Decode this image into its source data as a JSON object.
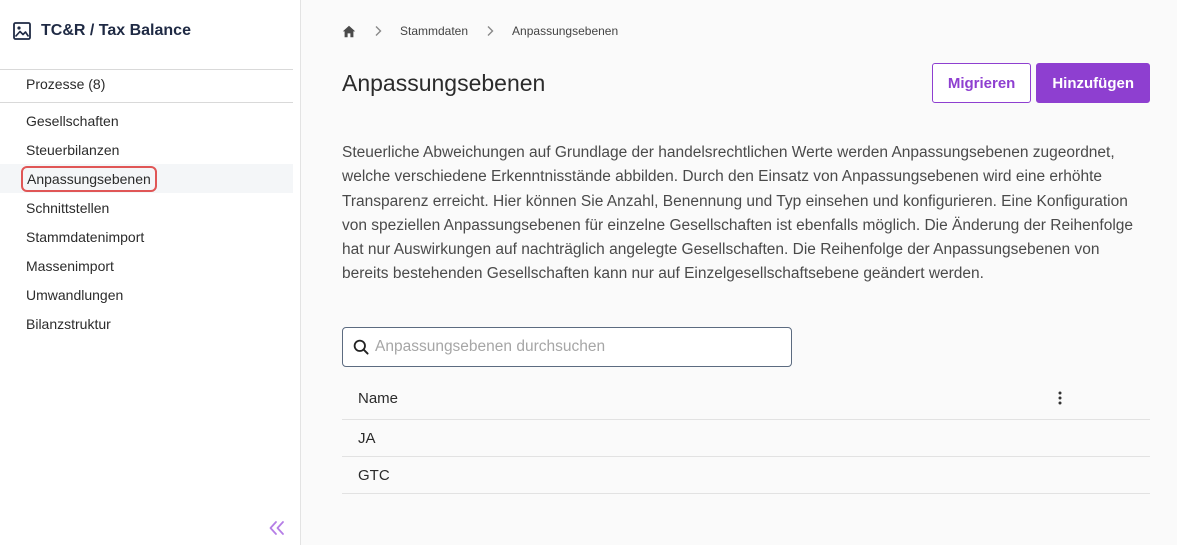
{
  "app": {
    "title": "TC&R / Tax Balance",
    "logo_icon": "image-icon"
  },
  "sidebar": {
    "processes_label": "Prozesse (8)",
    "items": [
      {
        "label": "Gesellschaften"
      },
      {
        "label": "Steuerbilanzen"
      },
      {
        "label": "Anpassungsebenen",
        "active": true
      },
      {
        "label": "Schnittstellen"
      },
      {
        "label": "Stammdatenimport"
      },
      {
        "label": "Massenimport"
      },
      {
        "label": "Umwandlungen"
      },
      {
        "label": "Bilanzstruktur"
      }
    ],
    "collapse_icon": "double-chevron-left-icon"
  },
  "breadcrumb": {
    "home_icon": "home-icon",
    "items": [
      "Stammdaten",
      "Anpassungsebenen"
    ]
  },
  "page": {
    "title": "Anpassungsebenen",
    "migrate_label": "Migrieren",
    "add_label": "Hinzufügen",
    "description": "Steuerliche Abweichungen auf Grundlage der handelsrechtlichen Werte werden Anpassungsebenen zugeordnet, welche verschiedene Erkenntnisstände abbilden. Durch den Einsatz von Anpassungsebenen wird eine erhöhte Transparenz erreicht. Hier können Sie Anzahl, Benennung und Typ einsehen und konfigurieren. Eine Konfiguration von speziellen Anpassungsebenen für einzelne Gesellschaften ist ebenfalls möglich. Die Änderung der Reihenfolge hat nur Auswirkungen auf nachträglich angelegte Gesellschaften. Die Reihenfolge der Anpassungsebenen von bereits bestehenden Gesellschaften kann nur auf Einzelgesellschaftsebene geändert werden."
  },
  "search": {
    "placeholder": "Anpassungsebenen durchsuchen",
    "value": ""
  },
  "table": {
    "columns": [
      {
        "label": "Name"
      }
    ],
    "rows": [
      {
        "name": "JA"
      },
      {
        "name": "GTC"
      }
    ]
  },
  "colors": {
    "accent": "#8e3fd0",
    "highlight_border": "#e05656"
  }
}
